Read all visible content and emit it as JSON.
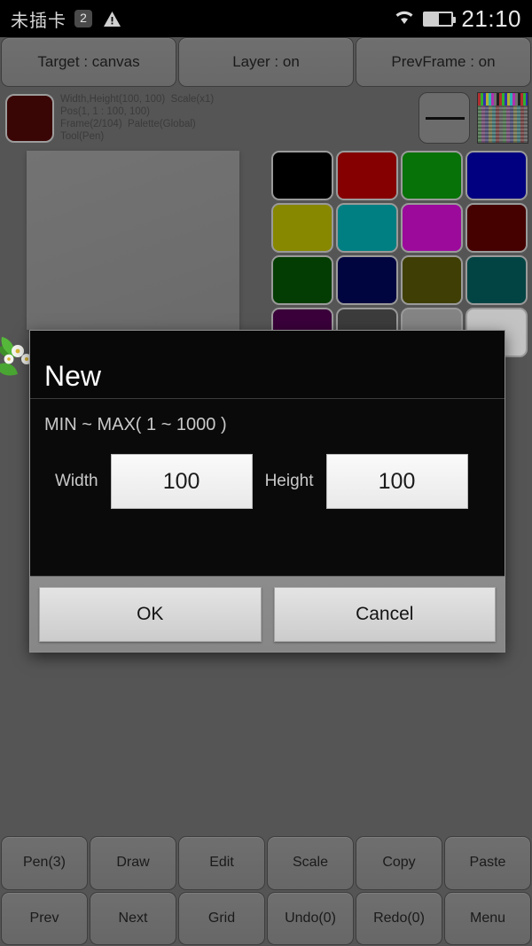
{
  "status_bar": {
    "carrier": "未插卡",
    "sim_badge": "2",
    "warning_icon": "warning-triangle-icon",
    "wifi_icon": "wifi-icon",
    "battery_icon": "battery-icon",
    "battery_level_pct": 52,
    "clock": "21:10"
  },
  "top_toolbar": {
    "buttons": [
      {
        "label": "Target : canvas"
      },
      {
        "label": "Layer : on"
      },
      {
        "label": "PrevFrame : on"
      }
    ]
  },
  "info_bar": {
    "current_color": "#3a0505",
    "lines": "Width,Height(100, 100)  Scale(x1)\nPos(1, 1 : 100, 100)\nFrame(2/104)  Palette(Global)\nTool(Pen)",
    "line_tool_icon": "horizontal-line-icon",
    "palette_preview_icon": "palette-preview-thumbnail"
  },
  "canvas": {
    "background": "#707070"
  },
  "palette": {
    "colors": [
      "#000000",
      "#850000",
      "#077207",
      "#000080",
      "#878700",
      "#007f82",
      "#9c0a9c",
      "#450000",
      "#043d04",
      "#000540",
      "#3f3f05",
      "#024444",
      "#3a003a",
      "#3c3c3c",
      "#848484",
      "#c3c3c3"
    ]
  },
  "dialog": {
    "title": "New",
    "range_text": "MIN ~ MAX( 1 ~ 1000 )",
    "width_label": "Width",
    "width_value": "100",
    "height_label": "Height",
    "height_value": "100",
    "ok_label": "OK",
    "cancel_label": "Cancel"
  },
  "bottom_toolbar": {
    "row1": [
      {
        "label": "Pen(3)"
      },
      {
        "label": "Draw"
      },
      {
        "label": "Edit"
      },
      {
        "label": "Scale"
      },
      {
        "label": "Copy"
      },
      {
        "label": "Paste"
      }
    ],
    "row2": [
      {
        "label": "Prev"
      },
      {
        "label": "Next"
      },
      {
        "label": "Grid"
      },
      {
        "label": "Undo(0)"
      },
      {
        "label": "Redo(0)"
      },
      {
        "label": "Menu"
      }
    ]
  }
}
